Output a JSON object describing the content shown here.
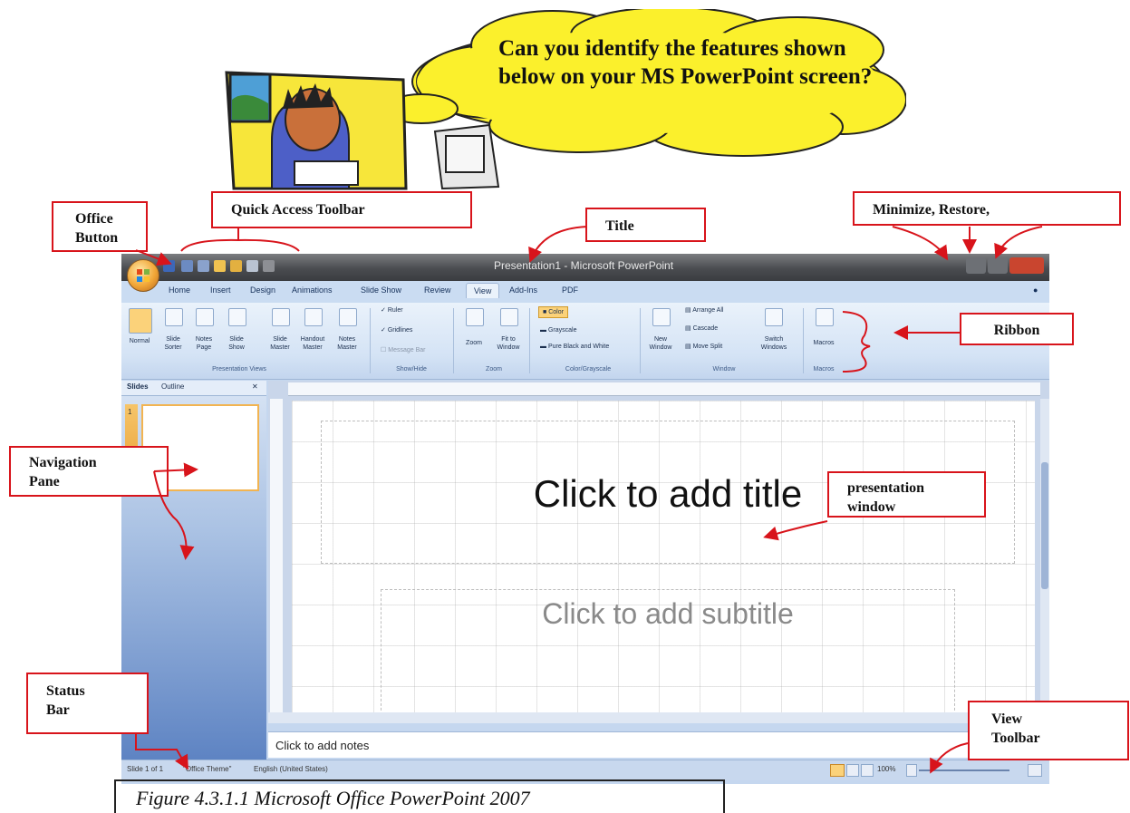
{
  "bubble": {
    "text": "Can you identify the features shown below on your MS PowerPoint screen?"
  },
  "callouts": {
    "office_button": {
      "line1": "Office",
      "line2": "Button"
    },
    "quick_access": "Quick Access Toolbar",
    "title": "Title",
    "window_controls": "Minimize, Restore,",
    "ribbon": "Ribbon",
    "navigation_pane": {
      "line1": "Navigation",
      "line2": "Pane"
    },
    "presentation_window": {
      "line1": "presentation",
      "line2": "window"
    },
    "status_bar": {
      "line1": "Status",
      "line2": "Bar"
    },
    "view_toolbar": {
      "line1": "View",
      "line2": "Toolbar"
    }
  },
  "app": {
    "title": "Presentation1 - Microsoft PowerPoint",
    "tabs": [
      "Home",
      "Insert",
      "Design",
      "Animations",
      "Slide Show",
      "Review",
      "View",
      "Add-Ins",
      "PDF"
    ],
    "active_tab": "View",
    "ribbon_groups": {
      "presentation_views": {
        "label": "Presentation Views",
        "buttons": [
          "Normal",
          "Slide Sorter",
          "Notes Page",
          "Slide Show",
          "Slide Master",
          "Handout Master",
          "Notes Master"
        ]
      },
      "show_hide": {
        "label": "Show/Hide",
        "items": [
          "Ruler",
          "Gridlines",
          "Message Bar"
        ]
      },
      "zoom": {
        "label": "Zoom",
        "buttons": [
          "Zoom",
          "Fit to Window"
        ]
      },
      "color": {
        "label": "Color/Grayscale",
        "items": [
          "Color",
          "Grayscale",
          "Pure Black and White"
        ]
      },
      "window": {
        "label": "Window",
        "items": [
          "New Window",
          "Arrange All",
          "Cascade",
          "Move Split",
          "Switch Windows"
        ]
      },
      "macros": {
        "label": "Macros",
        "buttons": [
          "Macros"
        ]
      }
    },
    "nav_tabs": [
      "Slides",
      "Outline"
    ],
    "slide_number": "1",
    "slide": {
      "title_placeholder": "Click to add title",
      "subtitle_placeholder": "Click to add subtitle"
    },
    "notes_placeholder": "Click to add notes",
    "status": {
      "slide_info": "Slide 1 of 1",
      "theme": "\"Office Theme\"",
      "language": "English (United States)",
      "zoom": "100%"
    }
  },
  "caption": "Figure 4.3.1.1 Microsoft Office PowerPoint 2007"
}
